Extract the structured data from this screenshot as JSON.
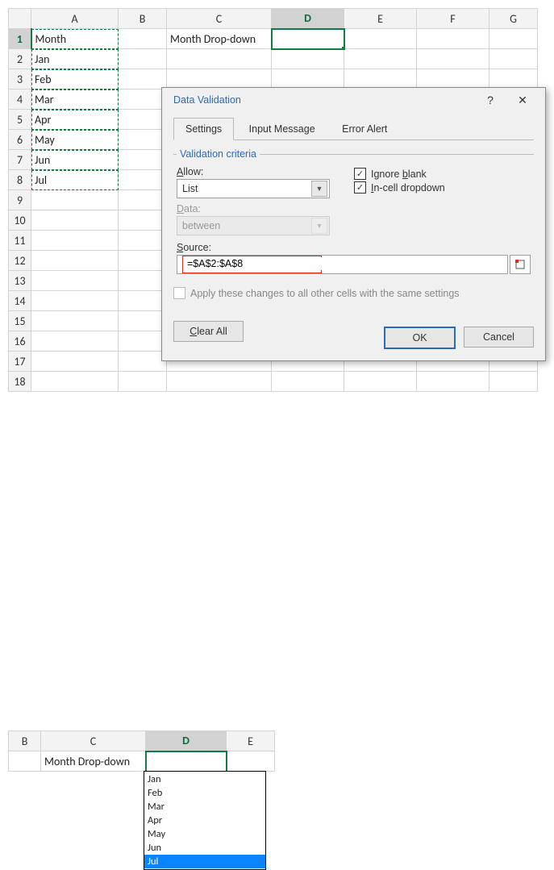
{
  "sheet1": {
    "columns": [
      "A",
      "B",
      "C",
      "D",
      "E",
      "F",
      "G"
    ],
    "rows": [
      "1",
      "2",
      "3",
      "4",
      "5",
      "6",
      "7",
      "8",
      "9",
      "10",
      "11",
      "12",
      "13",
      "14",
      "15",
      "16",
      "17",
      "18"
    ],
    "header_label": "Month",
    "c1_label": "Month Drop-down",
    "months": [
      "Jan",
      "Feb",
      "Mar",
      "Apr",
      "May",
      "Jun",
      "Jul"
    ],
    "active_col": "D",
    "active_row": "1"
  },
  "dialog": {
    "title": "Data Validation",
    "help": "?",
    "close": "✕",
    "tabs": {
      "settings": "Settings",
      "input": "Input Message",
      "error": "Error Alert"
    },
    "legend": "Validation criteria",
    "allow_label": "Allow:",
    "allow_value": "List",
    "ignore_blank": "Ignore blank",
    "incell_dd": "In-cell dropdown",
    "data_label": "Data:",
    "data_value": "between",
    "source_label": "Source:",
    "source_value": "=$A$2:$A$8",
    "apply_changes": "Apply these changes to all other cells with the same settings",
    "clear_all": "Clear All",
    "ok": "OK",
    "cancel": "Cancel"
  },
  "sheet2": {
    "columns": [
      "B",
      "C",
      "D",
      "E"
    ],
    "c_label": "Month Drop-down",
    "active_col": "D",
    "dropdown": [
      "Jan",
      "Feb",
      "Mar",
      "Apr",
      "May",
      "Jun",
      "Jul"
    ],
    "selected": "Jul"
  }
}
